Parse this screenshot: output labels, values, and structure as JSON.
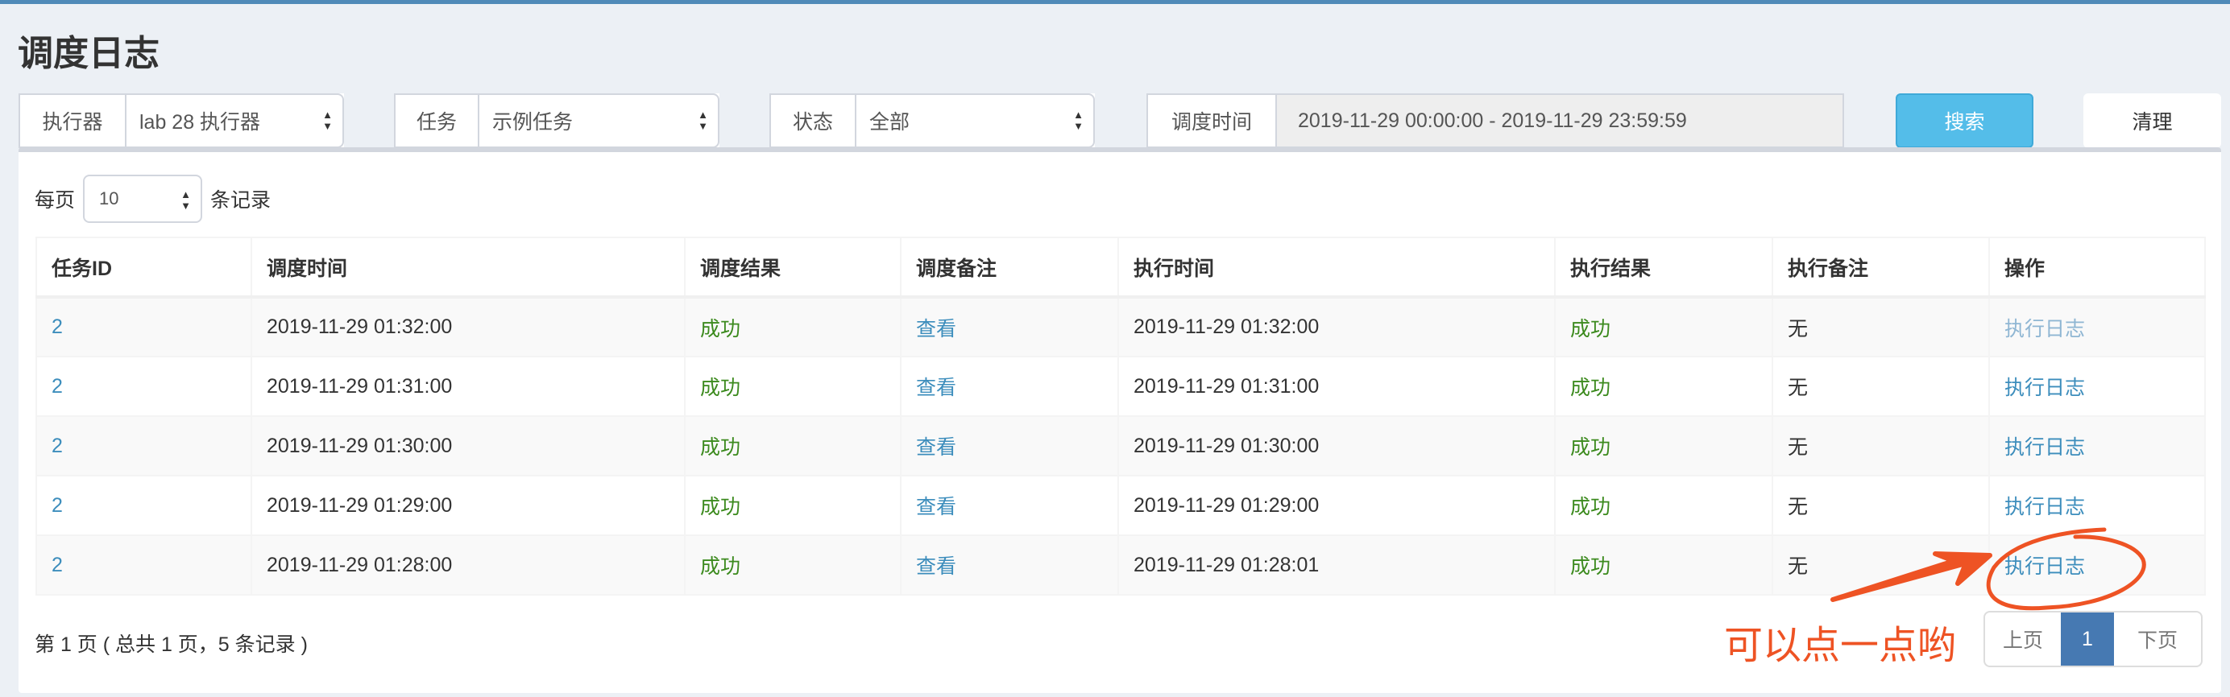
{
  "title": "调度日志",
  "filters": {
    "executor_label": "执行器",
    "executor_value": "lab 28 执行器",
    "task_label": "任务",
    "task_value": "示例任务",
    "status_label": "状态",
    "status_value": "全部",
    "time_label": "调度时间",
    "time_value": "2019-11-29 00:00:00 - 2019-11-29 23:59:59",
    "search": "搜索",
    "clear": "清理"
  },
  "per_page": {
    "prefix": "每页",
    "value": "10",
    "suffix": "条记录"
  },
  "columns": [
    "任务ID",
    "调度时间",
    "调度结果",
    "调度备注",
    "执行时间",
    "执行结果",
    "执行备注",
    "操作"
  ],
  "rows": [
    {
      "id": "2",
      "trigger_time": "2019-11-29 01:32:00",
      "trigger_result": "成功",
      "trigger_msg": "查看",
      "handle_time": "2019-11-29 01:32:00",
      "handle_result": "成功",
      "handle_msg": "无",
      "action": "执行日志"
    },
    {
      "id": "2",
      "trigger_time": "2019-11-29 01:31:00",
      "trigger_result": "成功",
      "trigger_msg": "查看",
      "handle_time": "2019-11-29 01:31:00",
      "handle_result": "成功",
      "handle_msg": "无",
      "action": "执行日志"
    },
    {
      "id": "2",
      "trigger_time": "2019-11-29 01:30:00",
      "trigger_result": "成功",
      "trigger_msg": "查看",
      "handle_time": "2019-11-29 01:30:00",
      "handle_result": "成功",
      "handle_msg": "无",
      "action": "执行日志"
    },
    {
      "id": "2",
      "trigger_time": "2019-11-29 01:29:00",
      "trigger_result": "成功",
      "trigger_msg": "查看",
      "handle_time": "2019-11-29 01:29:00",
      "handle_result": "成功",
      "handle_msg": "无",
      "action": "执行日志"
    },
    {
      "id": "2",
      "trigger_time": "2019-11-29 01:28:00",
      "trigger_result": "成功",
      "trigger_msg": "查看",
      "handle_time": "2019-11-29 01:28:01",
      "handle_result": "成功",
      "handle_msg": "无",
      "action": "执行日志"
    }
  ],
  "footer": "第 1 页 ( 总共 1 页，5 条记录 )",
  "pager": {
    "prev": "上页",
    "current": "1",
    "next": "下页"
  },
  "annotation": "可以点一点哟",
  "colors": {
    "accent": "#3c8dbc",
    "search": "#54bde9",
    "success": "#3c8a1e",
    "annotation": "#ee5324"
  }
}
